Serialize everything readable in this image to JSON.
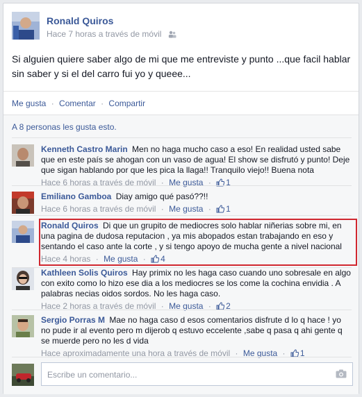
{
  "post": {
    "author": "Ronald Quiros",
    "meta": "Hace 7 horas a través de móvil",
    "text": "Si alguien quiere saber algo de mi que me entreviste y punto ...que facil hablar sin saber y si el del carro fui yo y queee...",
    "audience_icon": "friends-icon"
  },
  "actions": {
    "like": "Me gusta",
    "comment": "Comentar",
    "share": "Compartir",
    "separator": "·"
  },
  "likes_summary": "A 8 personas les gusta esto.",
  "comments": [
    {
      "name": "Kenneth Castro Marin",
      "text": "Men no haga mucho caso a eso! En realidad usted sabe que en este país se ahogan con un vaso de agua! El show se disfrutó y punto! Deje que sigan hablando por que les pica la llaga!! Tranquilo viejo!! Buena nota",
      "time": "Hace 6 horas a través de móvil",
      "like_label": "Me gusta",
      "likes": "1"
    },
    {
      "name": "Emiliano Gamboa",
      "text": "Diay amigo qué pasó??!!",
      "time": "Hace 6 horas a través de móvil",
      "like_label": "Me gusta",
      "likes": "1"
    },
    {
      "name": "Ronald Quiros",
      "text": "Di que un grupito de mediocres solo hablar niñerias sobre mi, en una pagina de dudosa reputacion , ya mis abopados estan trabajando en eso y sentando el caso ante la corte , y si tengo apoyo de mucha gente a nivel nacional",
      "time": "Hace 4 horas",
      "like_label": "Me gusta",
      "likes": "4"
    },
    {
      "name": "Kathleen Solis Quiros",
      "text": "Hay primix no les haga caso cuando uno sobresale en algo con exito como lo hizo ese dia a los mediocres se los come la cochina envidia . A palabras necias oidos sordos. No les haga caso.",
      "time": "Hace 2 horas a través de móvil",
      "like_label": "Me gusta",
      "likes": "2"
    },
    {
      "name": "Sergio Porras M",
      "text": "Mae no haga caso d esos comentarios disfrute d lo q hace ! yo no pude ir al evento pero m dijerob q estuvo eccelente ,sabe q pasa q ahi gente q se muerde pero no les d vida",
      "time": "Hace aproximadamente una hora a través de móvil",
      "like_label": "Me gusta",
      "likes": "1"
    }
  ],
  "composer": {
    "placeholder": "Escribe un comentario...",
    "attach_icon": "camera-icon"
  },
  "colors": {
    "link": "#3b5998",
    "meta": "#9197a3",
    "highlight": "#d0272f",
    "ufi_background": "#f6f7f8"
  }
}
